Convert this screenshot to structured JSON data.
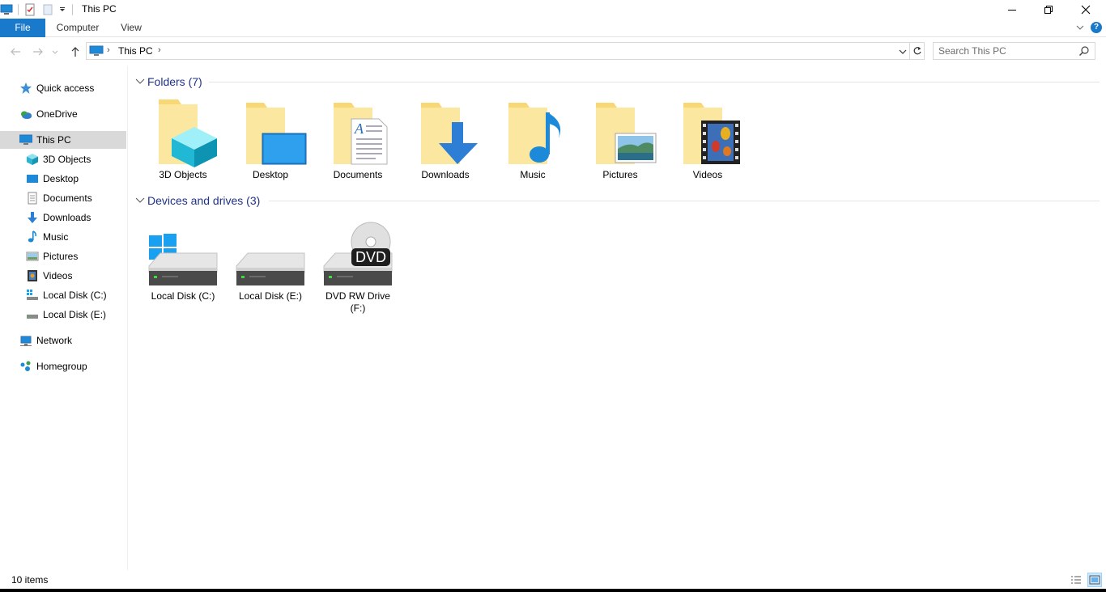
{
  "window": {
    "title": "This PC",
    "minimize_icon": "minimize-icon",
    "maximize_icon": "restore-icon",
    "close_icon": "close-icon"
  },
  "ribbon": {
    "tabs": [
      {
        "label": "File",
        "active": true
      },
      {
        "label": "Computer"
      },
      {
        "label": "View"
      }
    ],
    "help_label": "?"
  },
  "address": {
    "breadcrumb": [
      "This PC"
    ],
    "separator": "›"
  },
  "search": {
    "placeholder": "Search This PC"
  },
  "nav": {
    "items": [
      {
        "label": "Quick access",
        "icon": "star-icon"
      },
      {
        "label": "OneDrive",
        "icon": "onedrive-icon"
      },
      {
        "label": "This PC",
        "icon": "computer-icon",
        "selected": true
      },
      {
        "label": "3D Objects",
        "icon": "cube-icon"
      },
      {
        "label": "Desktop",
        "icon": "desktop-icon"
      },
      {
        "label": "Documents",
        "icon": "document-icon"
      },
      {
        "label": "Downloads",
        "icon": "download-icon"
      },
      {
        "label": "Music",
        "icon": "music-icon"
      },
      {
        "label": "Pictures",
        "icon": "picture-icon"
      },
      {
        "label": "Videos",
        "icon": "video-icon"
      },
      {
        "label": "Local Disk (C:)",
        "icon": "drive-icon"
      },
      {
        "label": "Local Disk (E:)",
        "icon": "drive-icon"
      },
      {
        "label": "Network",
        "icon": "network-icon"
      },
      {
        "label": "Homegroup",
        "icon": "homegroup-icon"
      }
    ]
  },
  "folders": {
    "title": "Folders (7)",
    "items": [
      {
        "label": "3D Objects",
        "icon": "3d-objects-folder-icon"
      },
      {
        "label": "Desktop",
        "icon": "desktop-folder-icon"
      },
      {
        "label": "Documents",
        "icon": "documents-folder-icon"
      },
      {
        "label": "Downloads",
        "icon": "downloads-folder-icon"
      },
      {
        "label": "Music",
        "icon": "music-folder-icon"
      },
      {
        "label": "Pictures",
        "icon": "pictures-folder-icon"
      },
      {
        "label": "Videos",
        "icon": "videos-folder-icon"
      }
    ]
  },
  "drives": {
    "title": "Devices and drives (3)",
    "items": [
      {
        "label": "Local Disk (C:)",
        "icon": "system-drive-icon"
      },
      {
        "label": "Local Disk (E:)",
        "icon": "drive-icon"
      },
      {
        "label": "DVD RW Drive\n(F:)",
        "line1": "DVD RW Drive",
        "line2": "(F:)",
        "icon": "dvd-drive-icon",
        "badge": "DVD"
      }
    ]
  },
  "status": {
    "count": "10 items"
  },
  "colors": {
    "accent": "#1979ca",
    "group_title": "#1e3287",
    "selected_bg": "#d9d9d9",
    "folder": "#f8d775"
  }
}
